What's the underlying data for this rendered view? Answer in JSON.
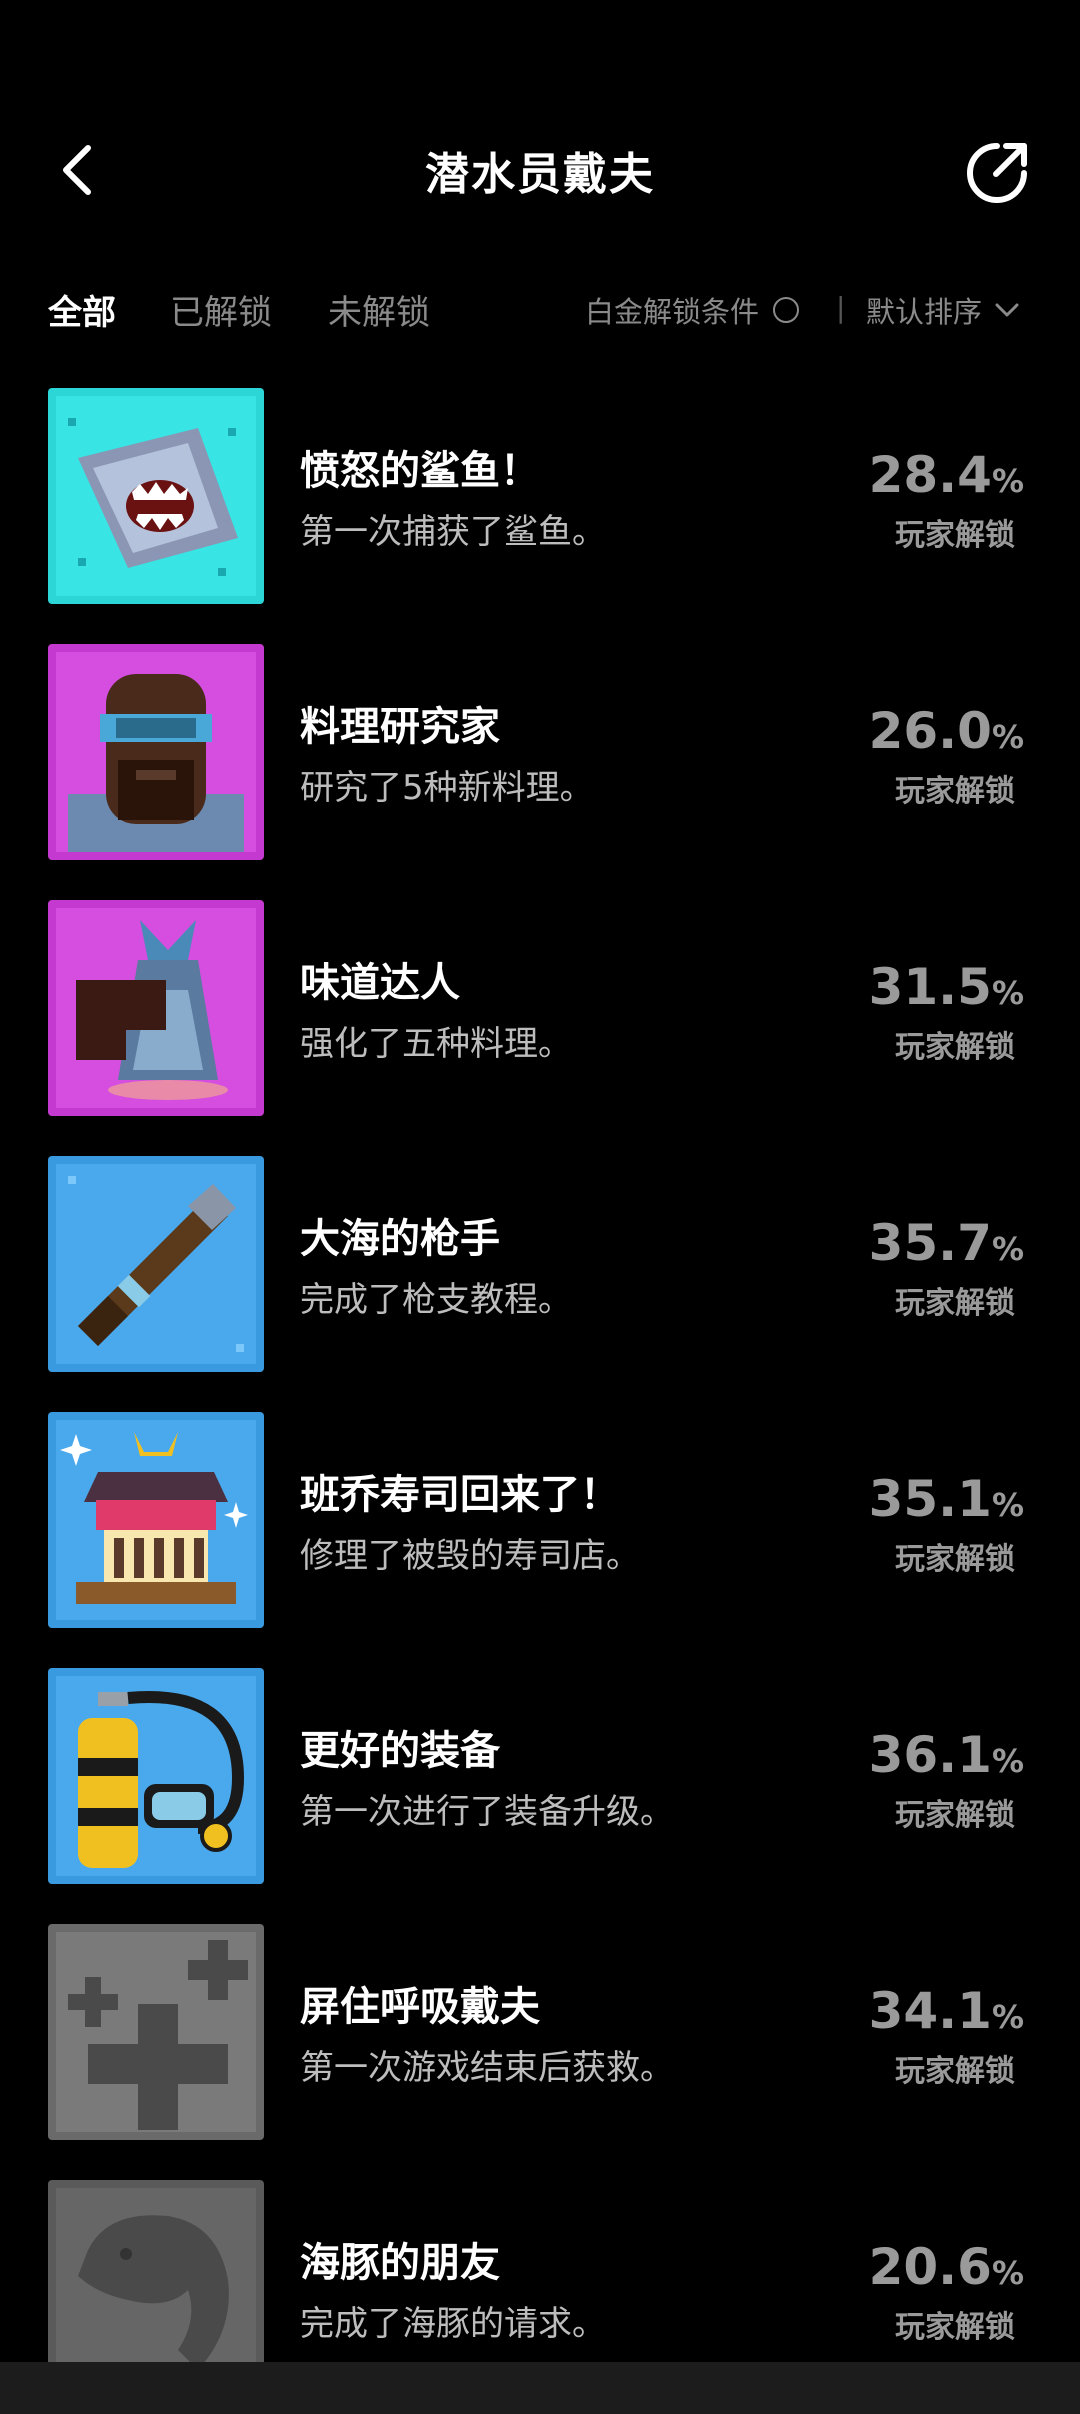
{
  "header": {
    "title": "潜水员戴夫",
    "back_icon": "chevron-left-icon",
    "share_icon": "share-icon"
  },
  "tabs": [
    {
      "label": "全部",
      "active": true
    },
    {
      "label": "已解锁",
      "active": false
    },
    {
      "label": "未解锁",
      "active": false
    }
  ],
  "filters": {
    "platinum_label": "白金解锁条件",
    "divider": "|",
    "sort_label": "默认排序"
  },
  "unlock_label": "玩家解锁",
  "achievements": [
    {
      "title": "愤怒的鲨鱼！",
      "desc": "第一次捕获了鲨鱼。",
      "percent": "28.4",
      "icon": "shark-icon",
      "locked": false
    },
    {
      "title": "料理研究家",
      "desc": "研究了5种新料理。",
      "percent": "26.0",
      "icon": "chef-diver-icon",
      "locked": false
    },
    {
      "title": "味道达人",
      "desc": "强化了五种料理。",
      "percent": "31.5",
      "icon": "fish-dish-icon",
      "locked": false
    },
    {
      "title": "大海的枪手",
      "desc": "完成了枪支教程。",
      "percent": "35.7",
      "icon": "harpoon-gun-icon",
      "locked": false
    },
    {
      "title": "班乔寿司回来了！",
      "desc": "修理了被毁的寿司店。",
      "percent": "35.1",
      "icon": "sushi-shop-icon",
      "locked": false
    },
    {
      "title": "更好的装备",
      "desc": "第一次进行了装备升级。",
      "percent": "36.1",
      "icon": "scuba-tank-icon",
      "locked": false
    },
    {
      "title": "屏住呼吸戴夫",
      "desc": "第一次游戏结束后获救。",
      "percent": "34.1",
      "icon": "medical-cross-icon",
      "locked": true
    },
    {
      "title": "海豚的朋友",
      "desc": "完成了海豚的请求。",
      "percent": "20.6",
      "icon": "dolphin-icon",
      "locked": true
    }
  ],
  "colors": {
    "background": "#000000",
    "text_primary": "#ffffff",
    "text_secondary": "#8a8a8a",
    "percent": "#9a9a9a"
  }
}
